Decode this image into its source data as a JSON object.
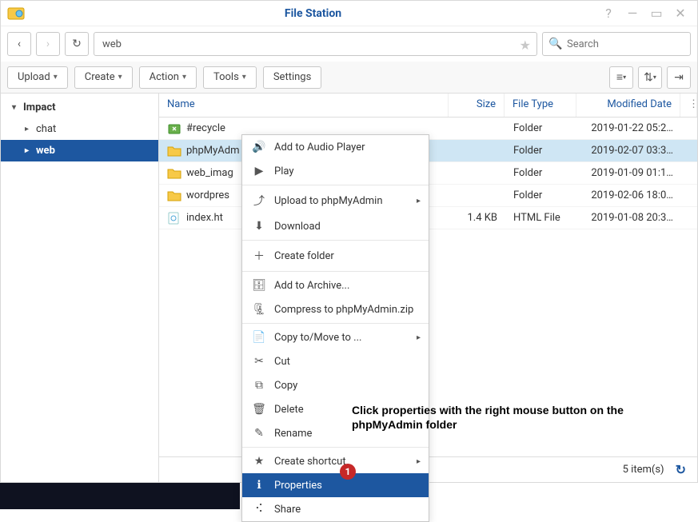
{
  "window": {
    "title": "File Station"
  },
  "nav": {
    "path_value": "web",
    "search_placeholder": "Search"
  },
  "toolbar": {
    "upload": "Upload",
    "create": "Create",
    "action": "Action",
    "tools": "Tools",
    "settings": "Settings"
  },
  "sidebar": {
    "root": "Impact",
    "items": [
      "chat",
      "web"
    ],
    "selected": "web"
  },
  "columns": {
    "name": "Name",
    "size": "Size",
    "type": "File Type",
    "date": "Modified Date"
  },
  "files": [
    {
      "icon": "recycle",
      "name": "#recycle",
      "size": "",
      "type": "Folder",
      "date": "2019-01-22 05:2…"
    },
    {
      "icon": "folder",
      "name": "phpMyAdmin",
      "size": "",
      "type": "Folder",
      "date": "2019-02-07 03:3…",
      "selected": true,
      "truncate": true
    },
    {
      "icon": "folder",
      "name": "web_images",
      "size": "",
      "type": "Folder",
      "date": "2019-01-09 01:1…",
      "truncate": true
    },
    {
      "icon": "folder",
      "name": "wordpress",
      "size": "",
      "type": "Folder",
      "date": "2019-02-06 18:0…",
      "truncate": true
    },
    {
      "icon": "html",
      "name": "index.html",
      "size": "1.4 KB",
      "type": "HTML File",
      "date": "2019-01-08 20:3…",
      "truncate": true
    }
  ],
  "status": {
    "count": "5 item(s)"
  },
  "context_menu": [
    {
      "icon": "speaker",
      "label": "Add to Audio Player"
    },
    {
      "icon": "play",
      "label": "Play"
    },
    {
      "sep": true
    },
    {
      "icon": "upload",
      "label": "Upload to phpMyAdmin",
      "sub": true
    },
    {
      "icon": "download",
      "label": "Download"
    },
    {
      "sep": true
    },
    {
      "icon": "newfolder",
      "label": "Create folder"
    },
    {
      "sep": true
    },
    {
      "icon": "archive",
      "label": "Add to Archive..."
    },
    {
      "icon": "zip",
      "label": "Compress to phpMyAdmin.zip"
    },
    {
      "sep": true
    },
    {
      "icon": "copymove",
      "label": "Copy to/Move to ...",
      "sub": true
    },
    {
      "icon": "cut",
      "label": "Cut"
    },
    {
      "icon": "copy",
      "label": "Copy"
    },
    {
      "icon": "trash",
      "label": "Delete"
    },
    {
      "icon": "pencil",
      "label": "Rename"
    },
    {
      "sep": true
    },
    {
      "icon": "star",
      "label": "Create shortcut",
      "sub": true
    },
    {
      "icon": "info",
      "label": "Properties",
      "selected": true
    },
    {
      "icon": "share",
      "label": "Share"
    }
  ],
  "annotation": {
    "text": "Click properties with the right mouse button on the phpMyAdmin folder",
    "badge": "1"
  }
}
